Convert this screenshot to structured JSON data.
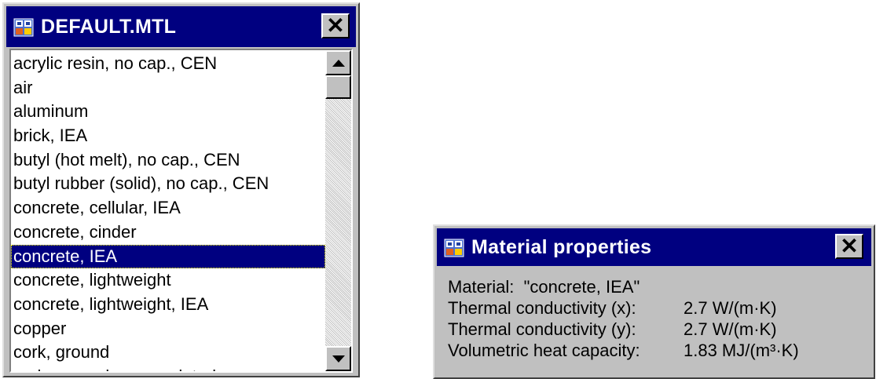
{
  "list_window": {
    "title": "DEFAULT.MTL",
    "close_glyph": "✕",
    "items": [
      {
        "label": "acrylic resin, no cap., CEN",
        "selected": false
      },
      {
        "label": "air",
        "selected": false
      },
      {
        "label": "aluminum",
        "selected": false
      },
      {
        "label": "brick, IEA",
        "selected": false
      },
      {
        "label": "butyl (hot melt), no cap., CEN",
        "selected": false
      },
      {
        "label": "butyl rubber (solid), no cap., CEN",
        "selected": false
      },
      {
        "label": "concrete, cellular, IEA",
        "selected": false
      },
      {
        "label": "concrete, cinder",
        "selected": false
      },
      {
        "label": "concrete, IEA",
        "selected": true
      },
      {
        "label": "concrete, lightweight",
        "selected": false
      },
      {
        "label": "concrete, lightweight, IEA",
        "selected": false
      },
      {
        "label": "copper",
        "selected": false
      },
      {
        "label": "cork, ground",
        "selected": false
      },
      {
        "label": "cork, ground, regranulated",
        "selected": false
      }
    ],
    "icons": {
      "title": "app-icon",
      "close": "close-icon",
      "scroll_up": "arrow-up-icon",
      "scroll_down": "arrow-down-icon"
    }
  },
  "properties_window": {
    "title": "Material properties",
    "close_glyph": "✕",
    "material_line": "Material:  \"concrete, IEA\"",
    "rows": [
      {
        "label": "Thermal conductivity (x):",
        "value": "2.7 W/(m·K)"
      },
      {
        "label": "Thermal conductivity (y):",
        "value": "2.7 W/(m·K)"
      },
      {
        "label": "Volumetric heat capacity:",
        "value": "1.83 MJ/(m³·K)"
      }
    ]
  },
  "colors": {
    "title_bar": "#000080",
    "window_face": "#c0c0c0",
    "selection": "#000080"
  }
}
